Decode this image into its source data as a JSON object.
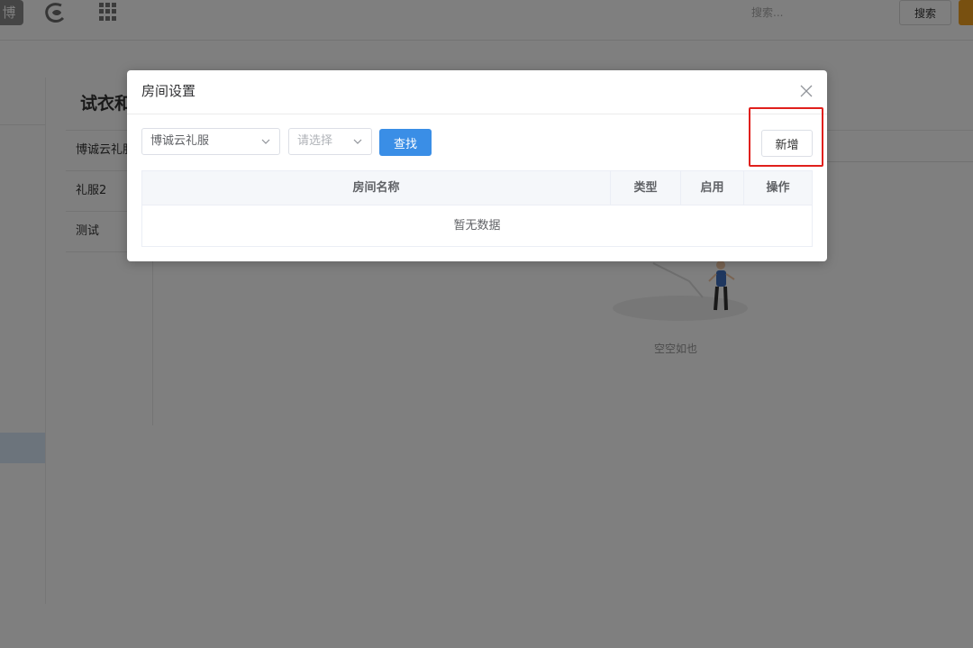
{
  "topbar": {
    "logo_text": "博",
    "search_placeholder": "搜索...",
    "search_button": "搜索"
  },
  "background": {
    "title": "试衣和",
    "stores": [
      "博诚云礼服",
      "礼服2",
      "测试"
    ],
    "empty_text": "空空如也"
  },
  "dialog": {
    "title": "房间设置",
    "store_select_value": "博诚云礼服",
    "type_select_placeholder": "请选择",
    "find_button": "查找",
    "add_button": "新增",
    "table": {
      "columns": [
        "房间名称",
        "类型",
        "启用",
        "操作"
      ],
      "empty_text": "暂无数据"
    }
  },
  "colors": {
    "primary": "#3a8ee6",
    "highlight": "#e0201c",
    "accent": "#f0a020"
  }
}
